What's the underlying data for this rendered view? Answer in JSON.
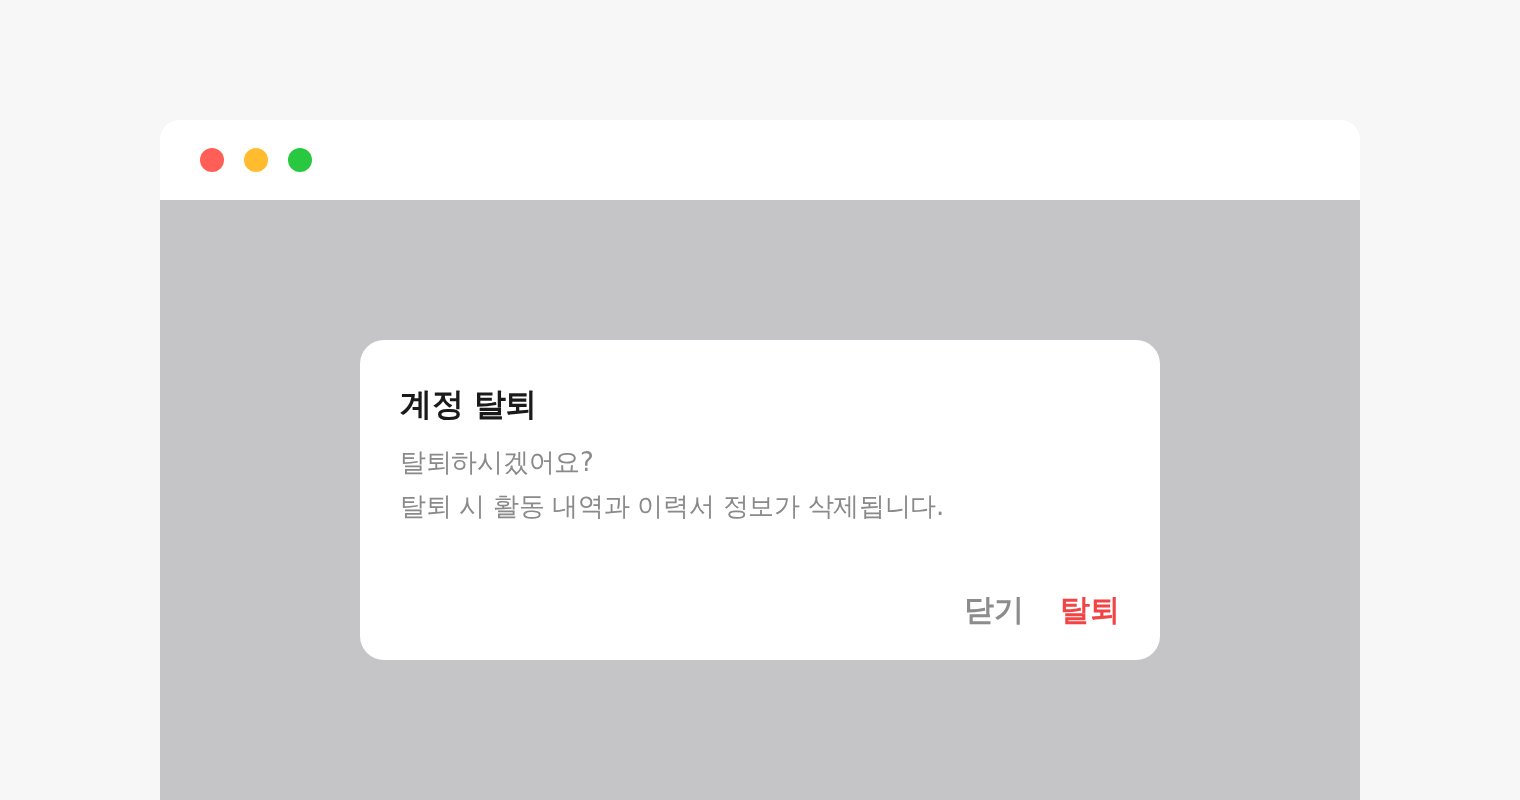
{
  "dialog": {
    "title": "계정 탈퇴",
    "message_lines": [
      "탈퇴하시겠어요?",
      "탈퇴 시 활동 내역과 이력서 정보가 삭제됩니다."
    ],
    "buttons": [
      {
        "label": "닫기",
        "kind": "cancel"
      },
      {
        "label": "탈퇴",
        "kind": "destructive"
      }
    ]
  }
}
